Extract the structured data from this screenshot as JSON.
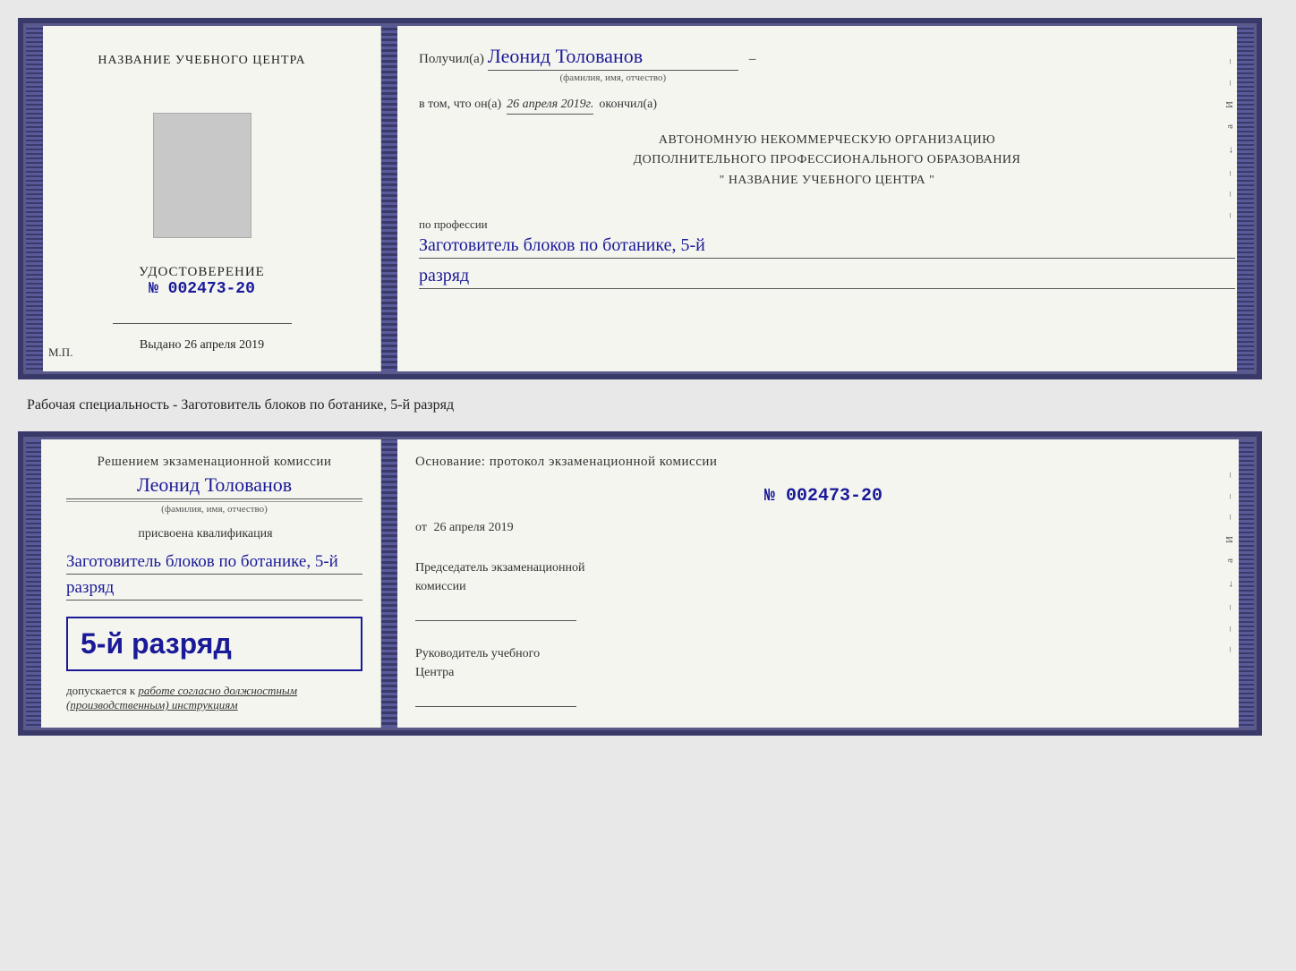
{
  "doc1": {
    "left": {
      "center_title": "НАЗВАНИЕ УЧЕБНОГО ЦЕНТРА",
      "udost_title": "УДОСТОВЕРЕНИЕ",
      "udost_number": "№ 002473-20",
      "vydano_label": "Выдано",
      "vydano_date": "26 апреля 2019",
      "mp": "М.П."
    },
    "right": {
      "poluchil": "Получил(а)",
      "name": "Леонид Толованов",
      "fio_label": "(фамилия, имя, отчество)",
      "dash": "–",
      "vtom_prefix": "в том, что он(а)",
      "vtom_date": "26 апреля 2019г.",
      "okonchill": "окончил(а)",
      "org_line1": "АВТОНОМНУЮ НЕКОММЕРЧЕСКУЮ ОРГАНИЗАЦИЮ",
      "org_line2": "ДОПОЛНИТЕЛЬНОГО ПРОФЕССИОНАЛЬНОГО ОБРАЗОВАНИЯ",
      "org_line3": "\"  НАЗВАНИЕ УЧЕБНОГО ЦЕНТРА  \"",
      "po_professii": "по профессии",
      "profession": "Заготовитель блоков по ботанике, 5-й",
      "razryad": "разряд"
    }
  },
  "specialty_text": "Рабочая специальность - Заготовитель блоков по ботанике, 5-й разряд",
  "doc2": {
    "left": {
      "resheniem": "Решением экзаменационной комиссии",
      "name": "Леонид Толованов",
      "fio_label": "(фамилия, имя, отчество)",
      "prisvoena": "присвоена квалификация",
      "kvalif": "Заготовитель блоков по ботанике, 5-й",
      "razryad": "разряд",
      "grade_number": "5-й разряд",
      "dopuskaetsya": "допускается к",
      "dopusk_italic": "работе согласно должностным (производственным) инструкциям"
    },
    "right": {
      "osnovanie": "Основание: протокол экзаменационной комиссии",
      "proto_no": "№  002473-20",
      "ot_prefix": "от",
      "ot_date": "26 апреля 2019",
      "predsedatel_line1": "Председатель экзаменационной",
      "predsedatel_line2": "комиссии",
      "rukovoditel_line1": "Руководитель учебного",
      "rukovoditel_line2": "Центра"
    }
  }
}
